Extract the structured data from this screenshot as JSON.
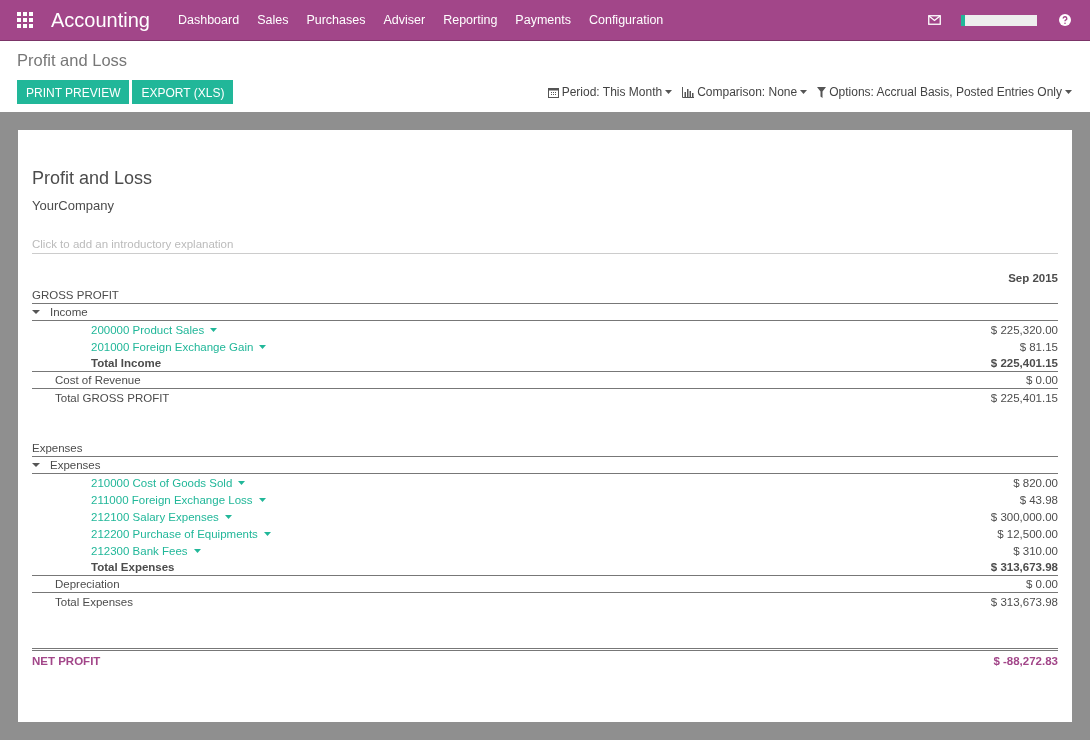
{
  "app": {
    "title": "Accounting"
  },
  "menu": [
    {
      "label": "Dashboard"
    },
    {
      "label": "Sales"
    },
    {
      "label": "Purchases"
    },
    {
      "label": "Adviser"
    },
    {
      "label": "Reporting"
    },
    {
      "label": "Payments"
    },
    {
      "label": "Configuration"
    }
  ],
  "breadcrumb": "Profit and Loss",
  "buttons": [
    "PRINT PREVIEW",
    "EXPORT (XLS)"
  ],
  "filters": [
    {
      "kind": "calendar",
      "label": "Period: This Month"
    },
    {
      "kind": "chart",
      "label": "Comparison: None"
    },
    {
      "kind": "filter",
      "label": "Options: Accrual Basis, Posted Entries Only"
    }
  ],
  "report": {
    "title": "Profit and Loss",
    "company": "YourCompany",
    "intro_placeholder": "Click to add an introductory explanation",
    "column": "Sep 2015",
    "sections": [
      {
        "label": "GROSS PROFIT",
        "groups": [
          {
            "label": "Income",
            "expanded": true,
            "accounts": [
              {
                "label": "200000 Product Sales",
                "amount": "$ 225,320.00"
              },
              {
                "label": "201000 Foreign Exchange Gain",
                "amount": "$ 81.15"
              }
            ],
            "total": {
              "label": "Total Income",
              "amount": "$ 225,401.15"
            }
          }
        ],
        "lines": [
          {
            "label": "Cost of Revenue",
            "amount": "$ 0.00"
          }
        ],
        "total": {
          "label": "Total GROSS PROFIT",
          "amount": "$ 225,401.15"
        }
      },
      {
        "label": "Expenses",
        "groups": [
          {
            "label": "Expenses",
            "expanded": true,
            "accounts": [
              {
                "label": "210000 Cost of Goods Sold",
                "amount": "$ 820.00"
              },
              {
                "label": "211000 Foreign Exchange Loss",
                "amount": "$ 43.98"
              },
              {
                "label": "212100 Salary Expenses",
                "amount": "$ 300,000.00"
              },
              {
                "label": "212200 Purchase of Equipments",
                "amount": "$ 12,500.00"
              },
              {
                "label": "212300 Bank Fees",
                "amount": "$ 310.00"
              }
            ],
            "total": {
              "label": "Total Expenses",
              "amount": "$ 313,673.98"
            }
          }
        ],
        "lines": [
          {
            "label": "Depreciation",
            "amount": "$ 0.00"
          }
        ],
        "total": {
          "label": "Total Expenses",
          "amount": "$ 313,673.98"
        }
      }
    ],
    "net": {
      "label": "NET PROFIT",
      "amount": "$ -88,272.83"
    }
  }
}
